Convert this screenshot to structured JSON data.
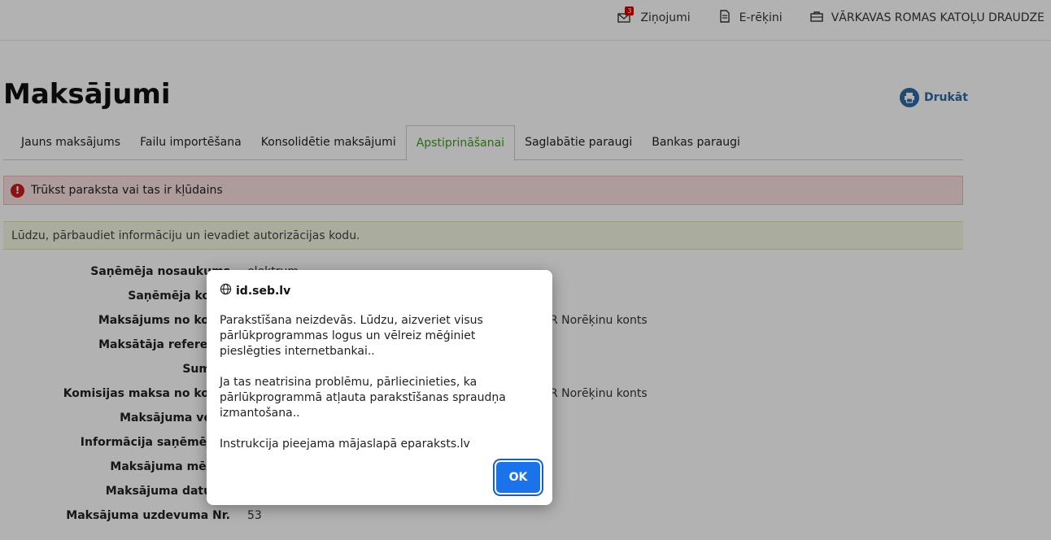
{
  "topnav": {
    "messages_label": "Ziņojumi",
    "messages_count": "3",
    "einvoices_label": "E-rēķini",
    "org_name": "VĀRKAVAS ROMAS KATOĻU DRAUDZE"
  },
  "page": {
    "title": "Maksājumi",
    "print_label": "Drukāt"
  },
  "tabs": [
    {
      "label": "Jauns maksājums"
    },
    {
      "label": "Failu importēšana"
    },
    {
      "label": "Konsolidētie maksājumi"
    },
    {
      "label": "Apstiprināšanai"
    },
    {
      "label": "Saglabātie paraugi"
    },
    {
      "label": "Bankas paraugi"
    }
  ],
  "alerts": {
    "error": "Trūkst paraksta vai tas ir kļūdains",
    "info": "Lūdzu, pārbaudiet informāciju un ievadiet autorizācijas kodu."
  },
  "form": {
    "rows": [
      {
        "label": "Saņēmēja nosaukums",
        "value": "elektrum"
      },
      {
        "label": "Saņēmēja konts",
        "value": ""
      },
      {
        "label": "Maksājums no konta",
        "value": "R Norēķinu konts"
      },
      {
        "label": "Maksātāja reference",
        "value": ""
      },
      {
        "label": "Summa",
        "value": ""
      },
      {
        "label": "Komisijas maksa no konta",
        "value": "R Norēķinu konts"
      },
      {
        "label": "Maksājuma veids",
        "value": ""
      },
      {
        "label": "Informācija saņēmējam",
        "value": ""
      },
      {
        "label": "Maksājuma mērķis",
        "value": ""
      },
      {
        "label": "Maksājuma datums",
        "value": ""
      },
      {
        "label": "Maksājuma uzdevuma Nr.",
        "value": "53"
      }
    ]
  },
  "dialog": {
    "origin": "id.seb.lv",
    "paragraph1": "Parakstīšana neizdevās. Lūdzu, aizveriet visus pārlūkprogrammas  logus un vēlreiz mēģiniet pieslēgties internetbankai..",
    "paragraph2": "Ja tas neatrisina problēmu, pārliecinieties, ka pārlūkprogrammā atļauta parakstīšanas spraudņa izmantošana..",
    "paragraph3": "Instrukcija pieejama mājaslapā eparaksts.lv",
    "ok_label": "OK"
  },
  "colors": {
    "accent_blue": "#2c6aa5",
    "active_tab_green": "#3c9b1f",
    "error_red": "#c81c1c",
    "dialog_button": "#1a73e8"
  },
  "icons": [
    "mail-icon",
    "document-icon",
    "briefcase-icon",
    "printer-icon",
    "error-icon",
    "globe-icon"
  ]
}
